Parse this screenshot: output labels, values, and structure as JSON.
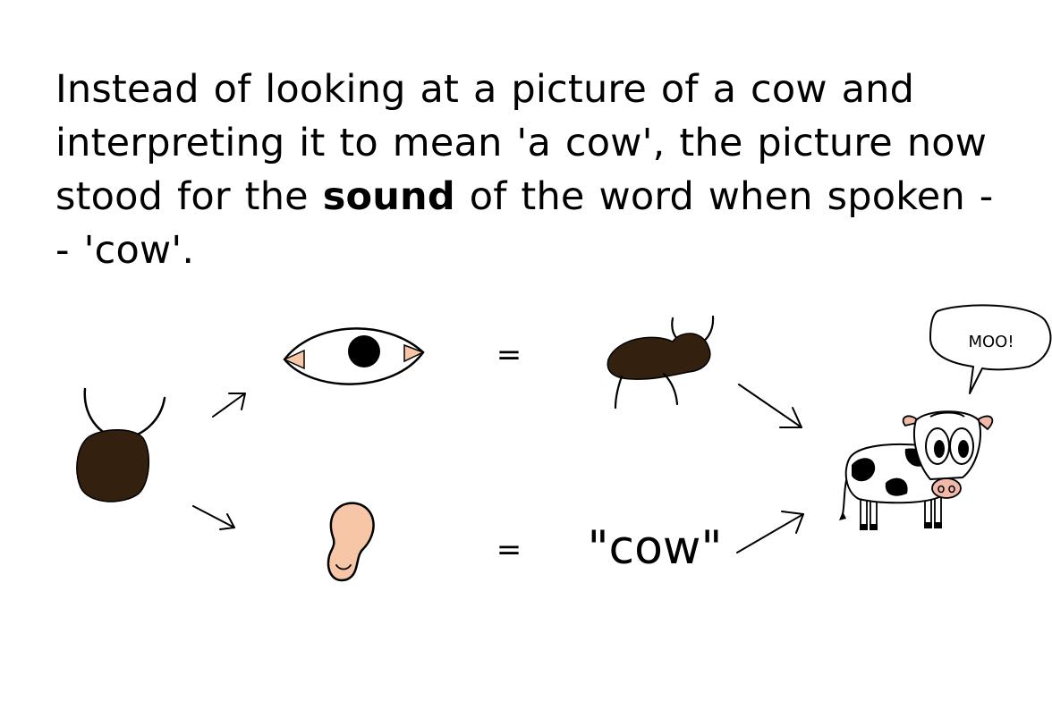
{
  "caption": {
    "line1": "Instead of looking at a picture of a cow and",
    "line2": "interpreting it to mean 'a cow', the picture now",
    "line3_before": "stood for the ",
    "line3_bold": "sound",
    "line3_after": " of the word when spoken -",
    "line4": "- 'cow'."
  },
  "diagram": {
    "equals_top": "=",
    "equals_bottom": "=",
    "spoken_word": "\"cow\"",
    "speech_bubble": "MOO!"
  },
  "colors": {
    "dark_brown": "#33200f",
    "ear_skin": "#f7c6a6",
    "cow_nose": "#f2b8a8",
    "black": "#000000",
    "white": "#ffffff"
  }
}
